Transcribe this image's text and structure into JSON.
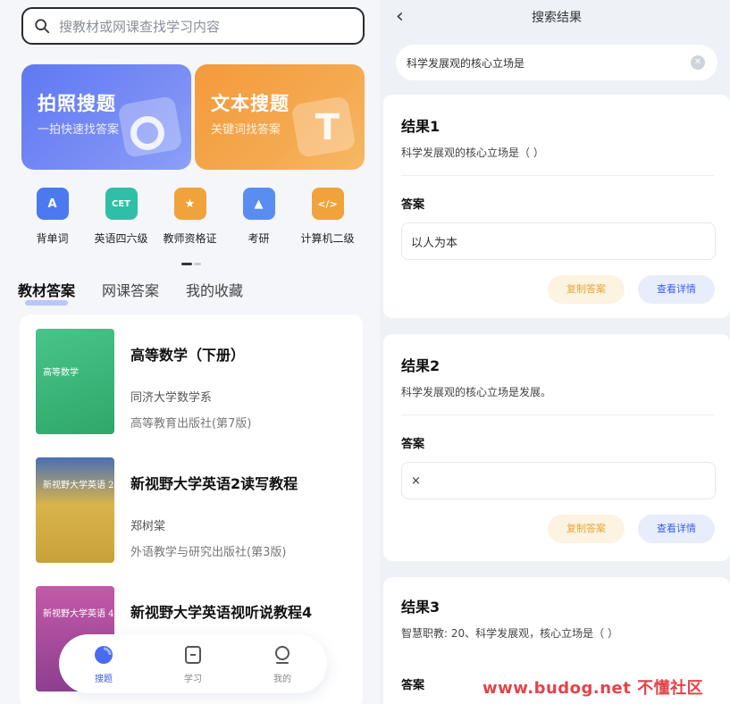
{
  "left": {
    "search": {
      "placeholder": "搜教材或网课查找学习内容"
    },
    "cards": [
      {
        "title": "拍照搜题",
        "subtitle": "一拍快速找答案"
      },
      {
        "title": "文本搜题",
        "subtitle": "关键词找答案"
      }
    ],
    "categories": [
      {
        "label": "背单词",
        "icon": "book-a-icon",
        "glyph": "A",
        "color": "#4a79f0"
      },
      {
        "label": "英语四六级",
        "icon": "cet-icon",
        "glyph": "CET",
        "color": "#2fbfa6"
      },
      {
        "label": "教师资格证",
        "icon": "certificate-icon",
        "glyph": "★",
        "color": "#f0a23b"
      },
      {
        "label": "考研",
        "icon": "graduation-cap-icon",
        "glyph": "▲",
        "color": "#5a8df2"
      },
      {
        "label": "计算机二级",
        "icon": "code-icon",
        "glyph": "</>",
        "color": "#f0a23b"
      }
    ],
    "tabs": [
      "教材答案",
      "网课答案",
      "我的收藏"
    ],
    "books": [
      {
        "title": "高等数学（下册）",
        "author": "同济大学数学系",
        "publisher": "高等教育出版社(第7版)",
        "cover_text": "高等数学",
        "cover_color": "#3cb878"
      },
      {
        "title": "新视野大学英语2读写教程",
        "author": "郑树棠",
        "publisher": "外语教学与研究出版社(第3版)",
        "cover_text": "新视野大学英语 2",
        "cover_color": "#c9a13a"
      },
      {
        "title": "新视野大学英语视听说教程4",
        "author": "",
        "publisher": "",
        "cover_text": "新视野大学英语 4",
        "cover_color": "#b04a9a"
      }
    ],
    "nav": [
      {
        "label": "搜题",
        "icon": "search-nav-icon"
      },
      {
        "label": "学习",
        "icon": "study-icon"
      },
      {
        "label": "我的",
        "icon": "profile-icon"
      }
    ]
  },
  "right": {
    "title": "搜索结果",
    "query": "科学发展观的核心立场是",
    "answer_label": "答案",
    "copy_label": "复制答案",
    "detail_label": "查看详情",
    "results": [
      {
        "label": "结果1",
        "question": "科学发展观的核心立场是（ ）",
        "answer": "以人为本"
      },
      {
        "label": "结果2",
        "question": "科学发展观的核心立场是发展。",
        "answer": "×"
      },
      {
        "label": "结果3",
        "question": "智慧职教: 20、科学发展观，核心立场是（  ）",
        "answer": ""
      }
    ]
  },
  "watermark": "www.budog.net 不懂社区"
}
